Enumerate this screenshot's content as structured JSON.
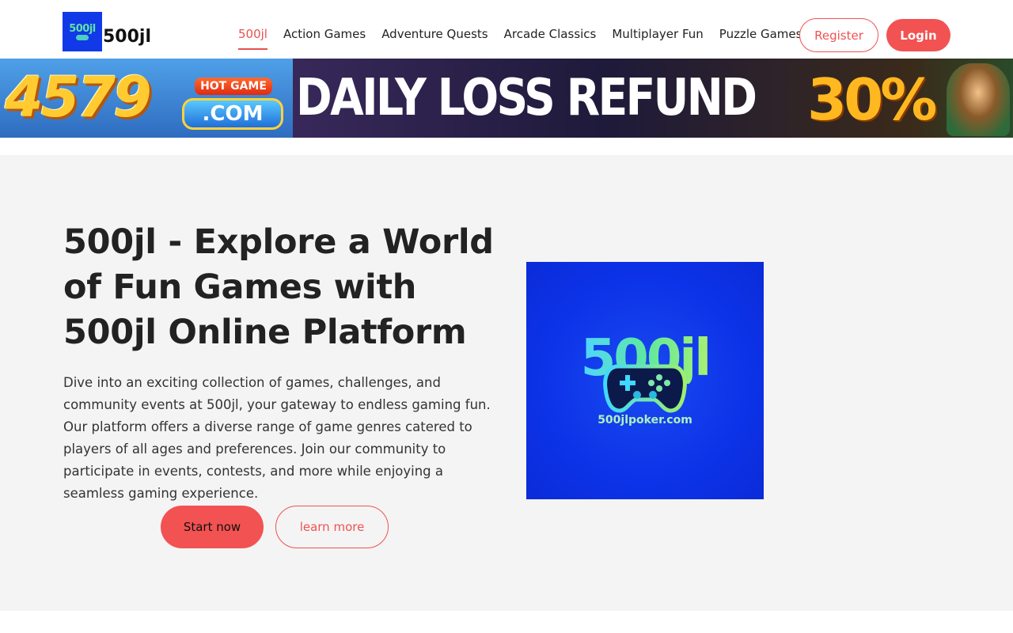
{
  "header": {
    "logo_text": "500jl",
    "site_name": "500jl",
    "nav": [
      {
        "label": "500jl",
        "active": true
      },
      {
        "label": "Action Games",
        "active": false
      },
      {
        "label": "Adventure Quests",
        "active": false
      },
      {
        "label": "Arcade Classics",
        "active": false
      },
      {
        "label": "Multiplayer Fun",
        "active": false
      },
      {
        "label": "Puzzle Games",
        "active": false
      }
    ],
    "register_label": "Register",
    "login_label": "Login"
  },
  "banner": {
    "number": "4579",
    "hot_game": "HOT GAME",
    "domain": ".COM",
    "headline": "DAILY LOSS REFUND",
    "percent": "30%"
  },
  "hero": {
    "title": "500jl - Explore a World of Fun Games with 500jl Online Platform",
    "description": "Dive into an exciting collection of games, challenges, and community events at 500jl, your gateway to endless gaming fun. Our platform offers a diverse range of game genres catered to players of all ages and preferences. Join our community to participate in events, contests, and more while enjoying a seamless gaming experience.",
    "start_label": "Start now",
    "learn_label": "learn more",
    "image_brand": "500jl",
    "image_domain": "500jlpoker.com"
  },
  "colors": {
    "accent": "#f25252",
    "hero_bg": "#f4f4f4",
    "logo_bg": "#1239e8"
  }
}
